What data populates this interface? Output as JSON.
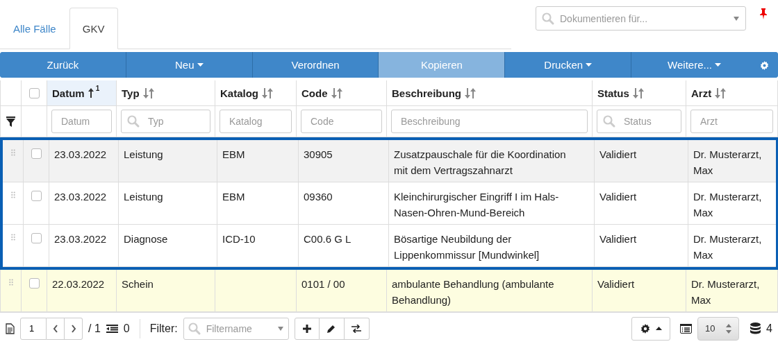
{
  "tabs": [
    {
      "label": "Alle Fälle",
      "selected": false
    },
    {
      "label": "GKV",
      "selected": true
    }
  ],
  "document_for": {
    "placeholder": "Dokumentieren für..."
  },
  "toolbar": [
    {
      "label": "Zurück",
      "dropdown": false,
      "disabled": false
    },
    {
      "label": "Neu",
      "dropdown": true,
      "disabled": false
    },
    {
      "label": "Verordnen",
      "dropdown": false,
      "disabled": false
    },
    {
      "label": "Kopieren",
      "dropdown": false,
      "disabled": true
    },
    {
      "label": "Drucken",
      "dropdown": true,
      "disabled": false
    },
    {
      "label": "Weitere...",
      "dropdown": true,
      "disabled": false
    }
  ],
  "table": {
    "select_all_checked": false,
    "columns": [
      {
        "label": "Datum",
        "sorted": true,
        "sort_index": "1",
        "filter_placeholder": "Datum",
        "filter_search": false
      },
      {
        "label": "Typ",
        "sorted": false,
        "filter_placeholder": "Typ",
        "filter_search": true
      },
      {
        "label": "Katalog",
        "sorted": false,
        "filter_placeholder": "Katalog",
        "filter_search": false
      },
      {
        "label": "Code",
        "sorted": false,
        "filter_placeholder": "Code",
        "filter_search": false
      },
      {
        "label": "Beschreibung",
        "sorted": false,
        "filter_placeholder": "Beschreibung",
        "filter_search": false
      },
      {
        "label": "Status",
        "sorted": false,
        "filter_placeholder": "Status",
        "filter_search": true
      },
      {
        "label": "Arzt",
        "sorted": false,
        "filter_placeholder": "Arzt",
        "filter_search": false
      }
    ],
    "rows": [
      {
        "kind": "entry",
        "selected": true,
        "highlighted": true,
        "checked": false,
        "cells": [
          "23.03.2022",
          "Leistung",
          "EBM",
          "30905",
          "Zusatzpauschale für die Koordination mit dem Vertragszahnarzt",
          "Validiert",
          "Dr. Musterarzt, Max"
        ]
      },
      {
        "kind": "entry",
        "selected": true,
        "highlighted": false,
        "checked": false,
        "cells": [
          "23.03.2022",
          "Leistung",
          "EBM",
          "09360",
          "Kleinchirurgischer Eingriff I im Hals-Nasen-Ohren-Mund-Bereich",
          "Validiert",
          "Dr. Musterarzt, Max"
        ]
      },
      {
        "kind": "entry",
        "selected": true,
        "highlighted": false,
        "checked": false,
        "cells": [
          "23.03.2022",
          "Diagnose",
          "ICD-10",
          "C00.6 G L",
          "Bösartige Neubildung der Lippenkommissur [Mundwinkel]",
          "Validiert",
          "Dr. Musterarzt, Max"
        ]
      },
      {
        "kind": "case",
        "selected": false,
        "highlighted": false,
        "checked": false,
        "cells": [
          "22.03.2022",
          "Schein",
          "",
          "0101 / 00",
          "ambulante Behandlung (ambulante Behandlung)",
          "Validiert",
          "Dr. Musterarzt, Max"
        ]
      }
    ]
  },
  "footer": {
    "page": "1",
    "page_total": "/ 1",
    "indent_count": "0",
    "filter_label": "Filter:",
    "filter_placeholder": "Filtername",
    "page_size": "10",
    "record_count": "4"
  }
}
